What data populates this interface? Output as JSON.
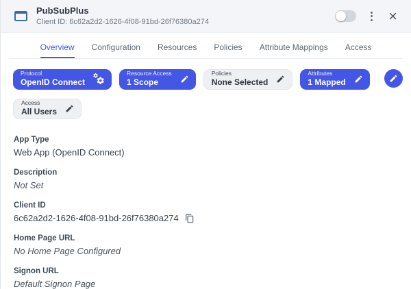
{
  "header": {
    "title": "PubSubPlus",
    "subtitle": "Client ID: 6c62a2d2-1626-4f08-91bd-26f76380a274",
    "toggle_state": "off"
  },
  "tabs": [
    {
      "label": "Overview",
      "active": true
    },
    {
      "label": "Configuration",
      "active": false
    },
    {
      "label": "Resources",
      "active": false
    },
    {
      "label": "Policies",
      "active": false
    },
    {
      "label": "Attribute Mappings",
      "active": false
    },
    {
      "label": "Access",
      "active": false
    }
  ],
  "quick_settings": [
    {
      "label": "Protocol",
      "value": "OpenID Connect",
      "style": "primary",
      "icon": "gears-icon"
    },
    {
      "label": "Resource Access",
      "value": "1 Scope",
      "style": "primary",
      "icon": "pencil-icon"
    },
    {
      "label": "Policies",
      "value": "None Selected",
      "style": "muted",
      "icon": "pencil-icon"
    },
    {
      "label": "Attributes",
      "value": "1 Mapped",
      "style": "primary",
      "icon": "pencil-icon"
    },
    {
      "label": "Access",
      "value": "All Users",
      "style": "muted",
      "icon": "pencil-icon"
    }
  ],
  "edit_button": {
    "icon": "pencil-icon"
  },
  "fields": [
    {
      "label": "App Type",
      "value": "Web App (OpenID Connect)",
      "italic": false,
      "copyable": false
    },
    {
      "label": "Description",
      "value": "Not Set",
      "italic": true,
      "copyable": false
    },
    {
      "label": "Client ID",
      "value": "6c62a2d2-1626-4f08-91bd-26f76380a274",
      "italic": false,
      "copyable": true
    },
    {
      "label": "Home Page URL",
      "value": "No Home Page Configured",
      "italic": true,
      "copyable": false
    },
    {
      "label": "Signon URL",
      "value": "Default Signon Page",
      "italic": true,
      "copyable": false
    }
  ],
  "colors": {
    "accent_blue": "#4356E6",
    "header_bg": "#F4F5F8",
    "muted_pill_bg": "#EEF0F3",
    "app_icon_blue": "#3E6B9E"
  }
}
